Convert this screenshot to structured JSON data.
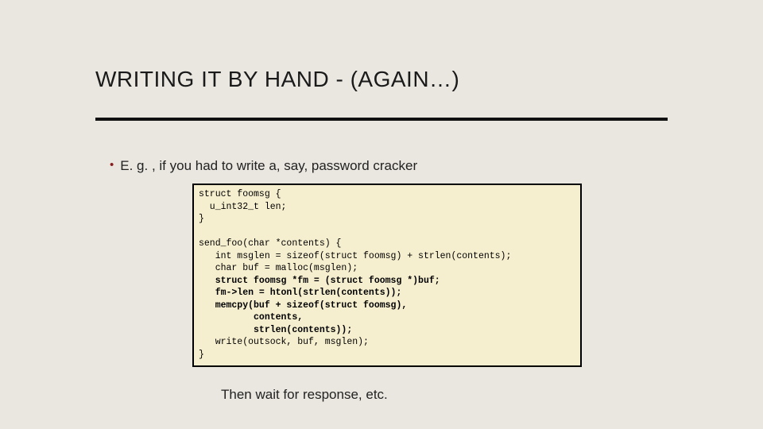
{
  "title": "WRITING IT BY HAND - (AGAIN…)",
  "bullet": "E. g. , if you had to write a, say, password cracker",
  "code": {
    "l1": "struct foomsg {",
    "l2": "  u_int32_t len;",
    "l3": "}",
    "l4": "",
    "l5": "send_foo(char *contents) {",
    "l6": "   int msglen = sizeof(struct foomsg) + strlen(contents);",
    "l7": "   char buf = malloc(msglen);",
    "l8": "   struct foomsg *fm = (struct foomsg *)buf;",
    "l9": "   fm->len = htonl(strlen(contents));",
    "l10": "   memcpy(buf + sizeof(struct foomsg),",
    "l11": "          contents,",
    "l12": "          strlen(contents));",
    "l13": "   write(outsock, buf, msglen);",
    "l14": "}"
  },
  "footnote": "Then wait for response, etc."
}
